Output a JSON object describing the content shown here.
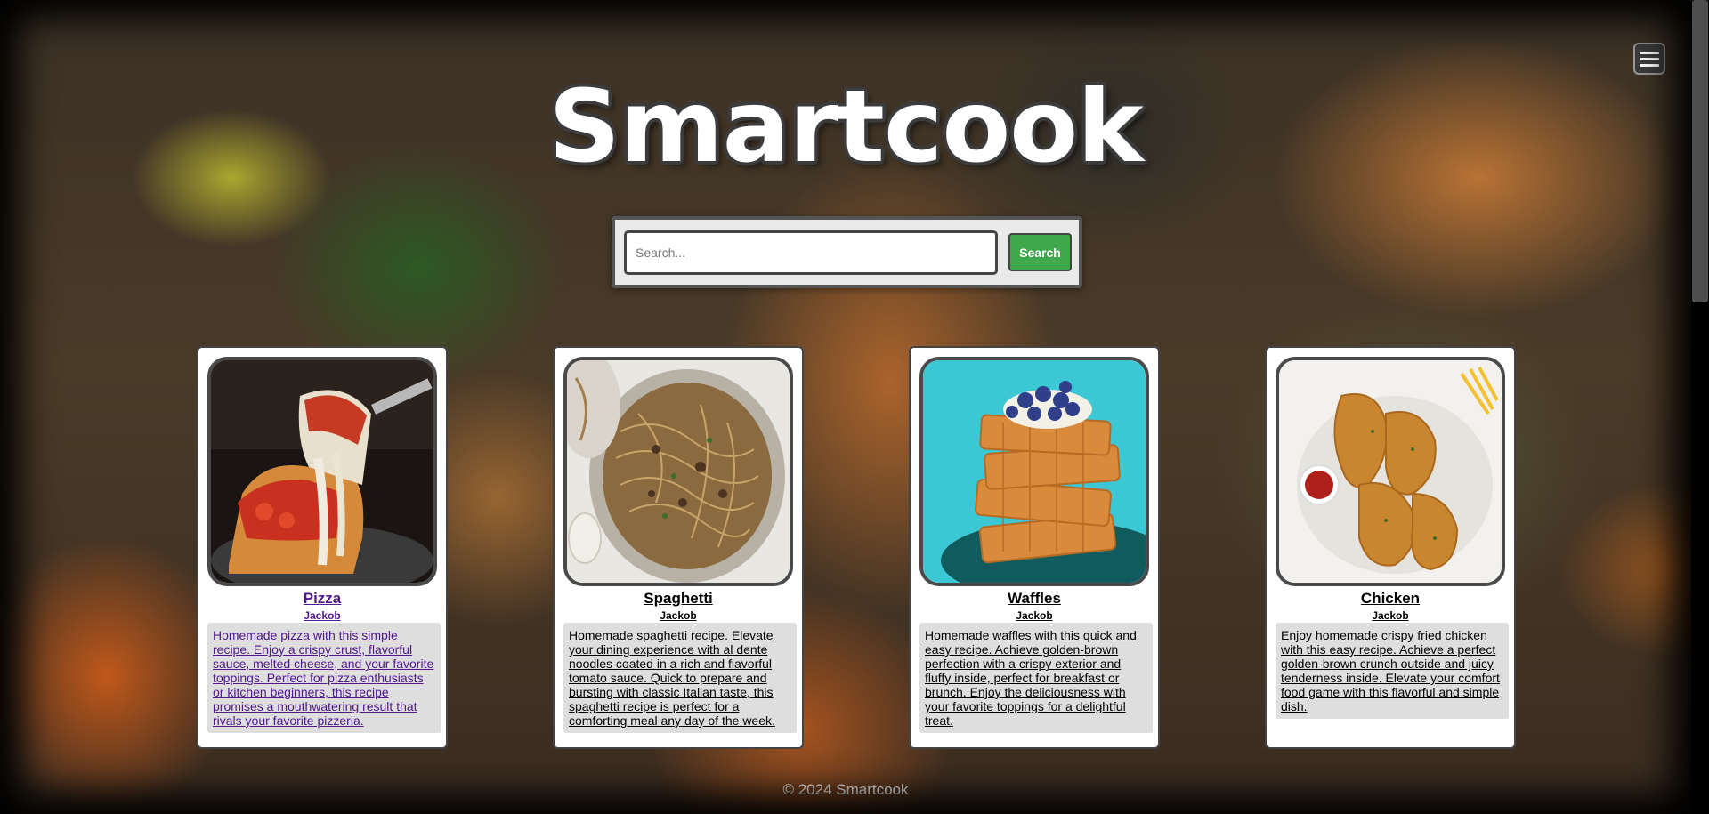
{
  "site": {
    "title": "Smartcook"
  },
  "menu": {
    "icon": "hamburger-menu-icon"
  },
  "search": {
    "placeholder": "Search...",
    "value": "",
    "button_label": "Search"
  },
  "recipes": [
    {
      "title": "Pizza",
      "author": "Jackob",
      "description": "Homemade pizza with this simple recipe. Enjoy a crispy crust, flavorful sauce, melted cheese, and your favorite toppings. Perfect for pizza enthusiasts or kitchen beginners, this recipe promises a mouthwatering result that rivals your favorite pizzeria.",
      "image": "pizza-photo",
      "visited": true
    },
    {
      "title": "Spaghetti",
      "author": "Jackob",
      "description": "Homemade spaghetti recipe. Elevate your dining experience with al dente noodles coated in a rich and flavorful tomato sauce. Quick to prepare and bursting with classic Italian taste, this spaghetti recipe is perfect for a comforting meal any day of the week.",
      "image": "spaghetti-photo",
      "visited": false
    },
    {
      "title": "Waffles",
      "author": "Jackob",
      "description": "Homemade waffles with this quick and easy recipe. Achieve golden-brown perfection with a crispy exterior and fluffy inside, perfect for breakfast or brunch. Enjoy the deliciousness with your favorite toppings for a delightful treat.",
      "image": "waffles-photo",
      "visited": false
    },
    {
      "title": "Chicken",
      "author": "Jackob",
      "description": "Enjoy homemade crispy fried chicken with this easy recipe. Achieve a perfect golden-brown crunch outside and juicy tenderness inside. Elevate your comfort food game with this flavorful and simple dish.",
      "image": "fried-chicken-photo",
      "visited": false
    }
  ],
  "footer": {
    "text": "© 2024 Smartcook"
  },
  "colors": {
    "search_button": "#3fa84c",
    "visited_link": "#52188c",
    "card_text_bg": "#dedede"
  }
}
